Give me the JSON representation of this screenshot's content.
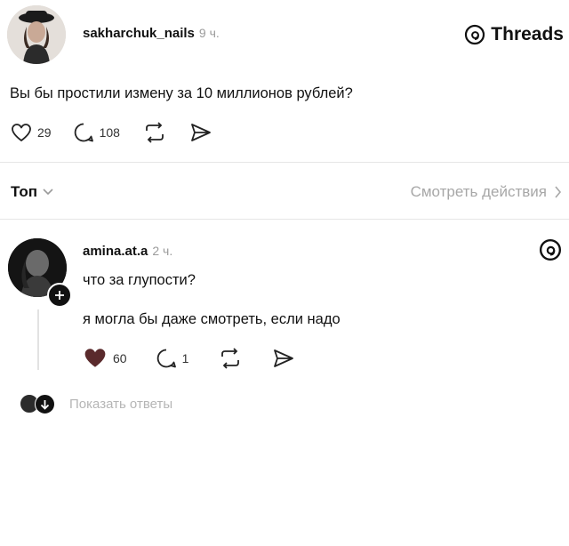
{
  "brand": {
    "name": "Threads"
  },
  "post": {
    "username": "sakharchuk_nails",
    "time": "9 ч.",
    "text": "Вы бы простили измену за 10 миллионов рублей?",
    "likes": "29",
    "replies": "108"
  },
  "sort": {
    "label": "Топ",
    "activity_link": "Смотреть действия"
  },
  "reply": {
    "username": "amina.at.a",
    "time": "2 ч.",
    "lines": [
      "что за глупости?",
      "я могла бы даже смотреть, если надо"
    ],
    "likes": "60",
    "replies": "1"
  },
  "show_replies": {
    "label": "Показать ответы"
  },
  "colors": {
    "like_filled": "#5a2a2c",
    "muted": "#a7a7a7"
  }
}
